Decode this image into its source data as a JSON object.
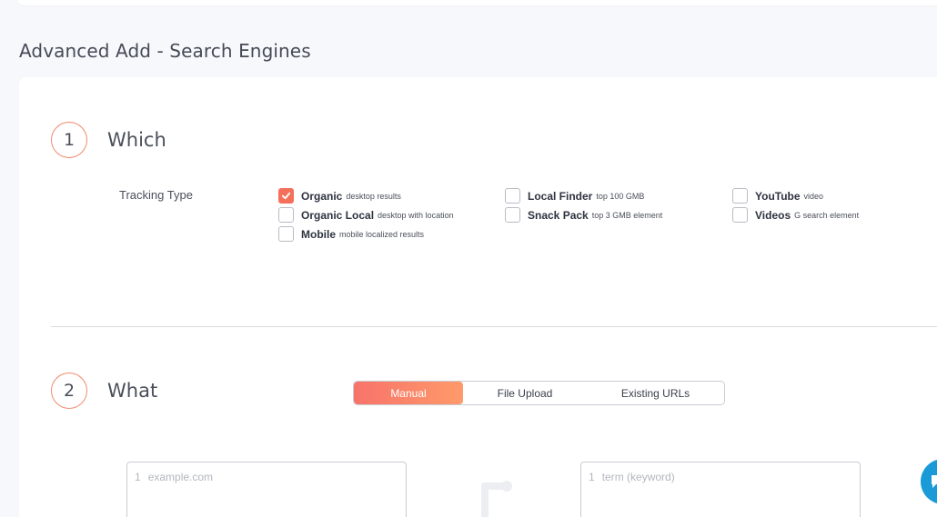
{
  "page": {
    "title": "Advanced Add - Search Engines"
  },
  "step1": {
    "number": "1",
    "title": "Which",
    "tracking_label": "Tracking Type",
    "options": [
      {
        "main": "Organic",
        "sub": "desktop results",
        "checked": true
      },
      {
        "main": "Organic Local",
        "sub": "desktop with location",
        "checked": false
      },
      {
        "main": "Mobile",
        "sub": "mobile localized results",
        "checked": false
      },
      {
        "main": "Local Finder",
        "sub": "top 100 GMB",
        "checked": false
      },
      {
        "main": "Snack Pack",
        "sub": "top 3 GMB element",
        "checked": false
      },
      {
        "main": "YouTube",
        "sub": "video",
        "checked": false
      },
      {
        "main": "Videos",
        "sub": "G search element",
        "checked": false
      }
    ]
  },
  "step2": {
    "number": "2",
    "title": "What",
    "tabs": [
      {
        "label": "Manual",
        "active": true
      },
      {
        "label": "File Upload",
        "active": false
      },
      {
        "label": "Existing URLs",
        "active": false
      }
    ],
    "url_input": {
      "line_number": "1",
      "placeholder": "example.com"
    },
    "keyword_input": {
      "line_number": "1",
      "placeholder": "term (keyword)"
    }
  },
  "icons": {
    "check": "check-icon",
    "connector": "connector-icon",
    "chat": "chat-icon"
  },
  "colors": {
    "accent": "#f4705b",
    "accent_gradient_end": "#ff9a6a",
    "chat": "#1a9bd7",
    "step_ring": "#f08a6c"
  }
}
